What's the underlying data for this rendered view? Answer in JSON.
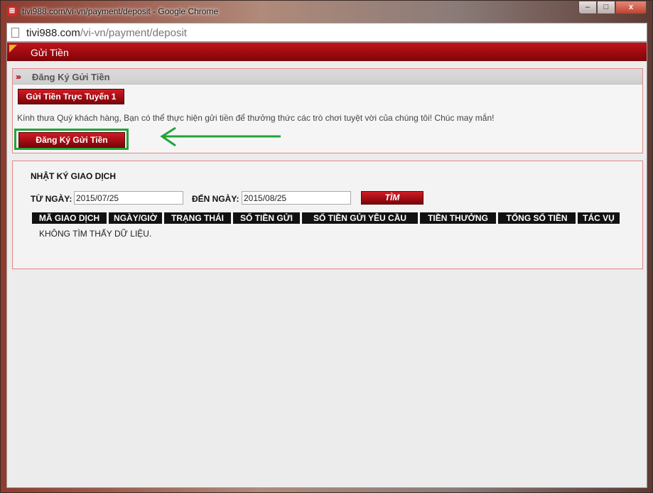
{
  "window": {
    "title": "tivi988.com/vi-vn/payment/deposit - Google Chrome",
    "url_domain": "tivi988.com",
    "url_path": "/vi-vn/payment/deposit",
    "minimize": "–",
    "maximize": "□",
    "close": "x"
  },
  "header": {
    "title": "Gửi Tiền"
  },
  "register_panel": {
    "title": "Đăng Ký Gửi Tiền",
    "tab_label": "Gửi Tiền Trực Tuyến 1",
    "info_text": "Kính thưa Quý khách hàng, Bạn có thể thực hiện gửi tiền để thưởng thức các trò chơi tuyệt vời của chúng tôi! Chúc may mắn!",
    "register_button": "Đăng Ký Gửi Tiền"
  },
  "history": {
    "title": "NHẬT KÝ GIAO DỊCH",
    "from_label": "TỪ NGÀY:",
    "from_value": "2015/07/25",
    "to_label": "ĐẾN NGÀY:",
    "to_value": "2015/08/25",
    "search_button": "TÌM",
    "columns": [
      "MÃ GIAO DỊCH",
      "NGÀY/GIỜ",
      "TRẠNG THÁI",
      "SỐ TIỀN GỬI",
      "SỐ TIỀN GỬI YÊU CẦU",
      "TIỀN THƯỞNG",
      "TỔNG SỐ TIỀN",
      "TÁC VỤ"
    ],
    "empty_text": "KHÔNG TÌM THẤY DỮ LIỆU."
  },
  "colors": {
    "brand_red": "#c1121b",
    "highlight_green": "#22a33c"
  }
}
